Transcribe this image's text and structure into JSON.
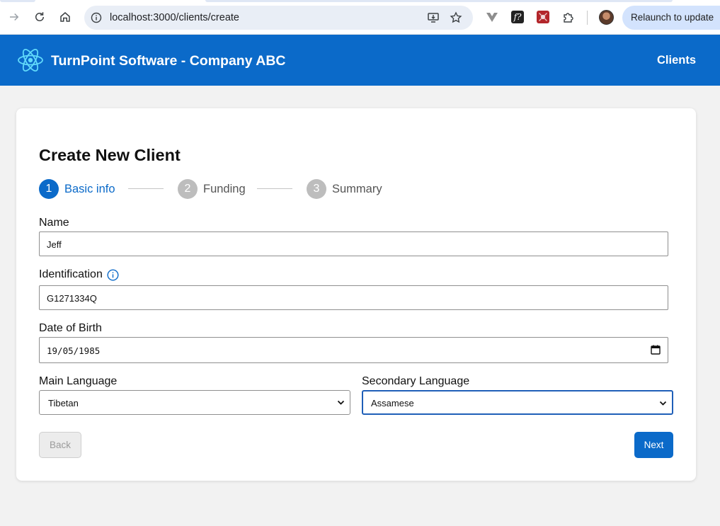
{
  "browser": {
    "url": "localhost:3000/clients/create",
    "relaunch_label": "Relaunch to update"
  },
  "header": {
    "title": "TurnPoint Software - Company ABC",
    "nav_clients": "Clients"
  },
  "form": {
    "title": "Create New Client",
    "steps": [
      {
        "number": "1",
        "label": "Basic info",
        "active": true
      },
      {
        "number": "2",
        "label": "Funding",
        "active": false
      },
      {
        "number": "3",
        "label": "Summary",
        "active": false
      }
    ],
    "name_label": "Name",
    "name_value": "Jeff",
    "identification_label": "Identification",
    "identification_value": "G1271334Q",
    "dob_label": "Date of Birth",
    "dob_value": "19/05/1985",
    "main_language_label": "Main Language",
    "main_language_value": "Tibetan",
    "secondary_language_label": "Secondary Language",
    "secondary_language_value": "Assamese",
    "back_label": "Back",
    "next_label": "Next"
  },
  "colors": {
    "primary": "#0b6ac9",
    "page_bg": "#f2f2f2"
  }
}
